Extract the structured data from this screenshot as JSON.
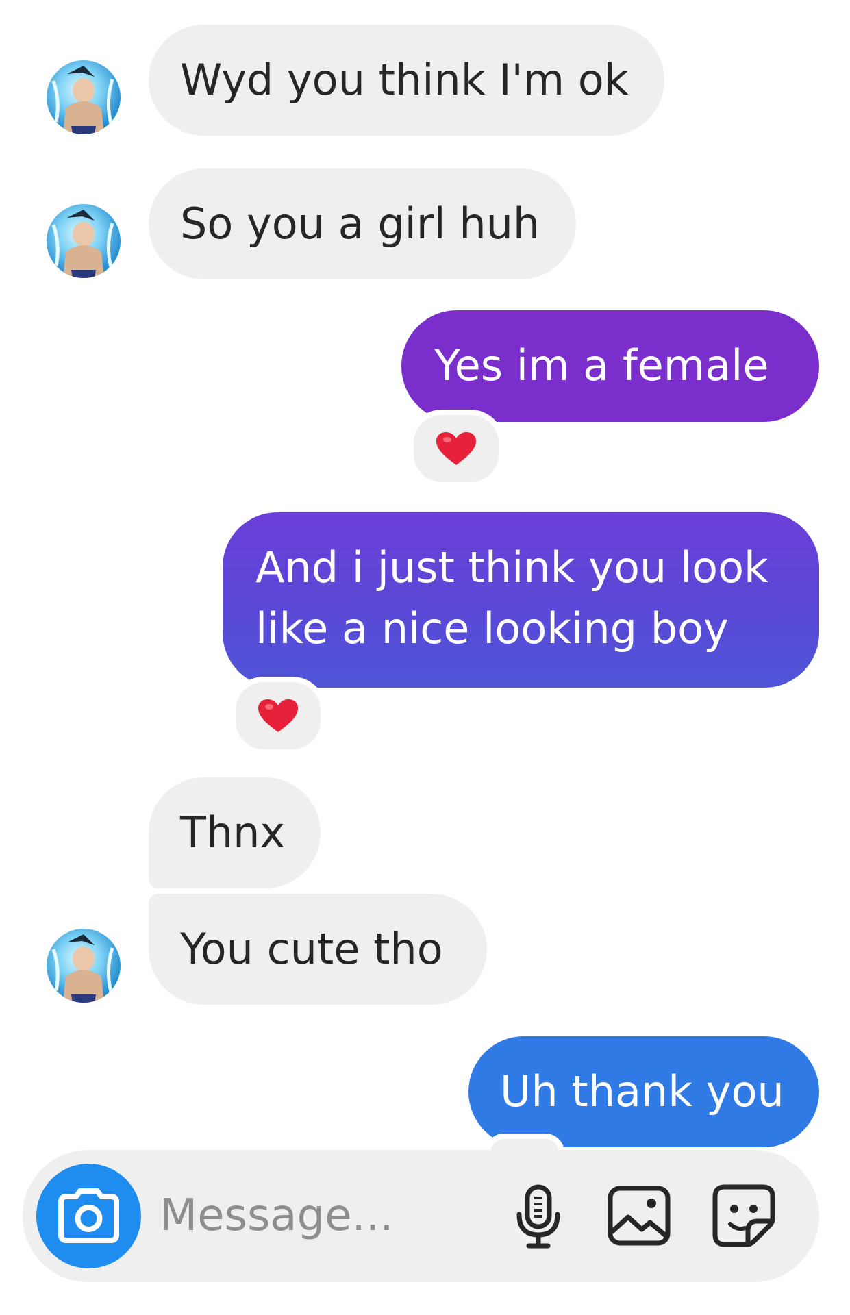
{
  "conversation": {
    "messages": [
      {
        "sender": "other",
        "text": "Wyd you think I'm ok"
      },
      {
        "sender": "other",
        "text": "So you a girl huh"
      },
      {
        "sender": "me",
        "text": "Yes im a female",
        "reaction": "❤"
      },
      {
        "sender": "me",
        "text": "And i just think you look like a nice looking boy",
        "reaction": "❤"
      },
      {
        "sender": "other",
        "text": "Thnx"
      },
      {
        "sender": "other",
        "text": "You cute tho"
      },
      {
        "sender": "me",
        "text": "Uh thank you"
      }
    ]
  },
  "composer": {
    "placeholder": "Message...",
    "icons": [
      "camera-icon",
      "microphone-icon",
      "gallery-icon",
      "sticker-icon"
    ]
  },
  "colors": {
    "incoming_bubble": "#efefef",
    "outgoing_purple": "#7a2ecc",
    "outgoing_violet": "#5a48d6",
    "outgoing_blue": "#2f7ae5",
    "camera_button": "#1f8cf0",
    "heart": "#e8213a"
  }
}
